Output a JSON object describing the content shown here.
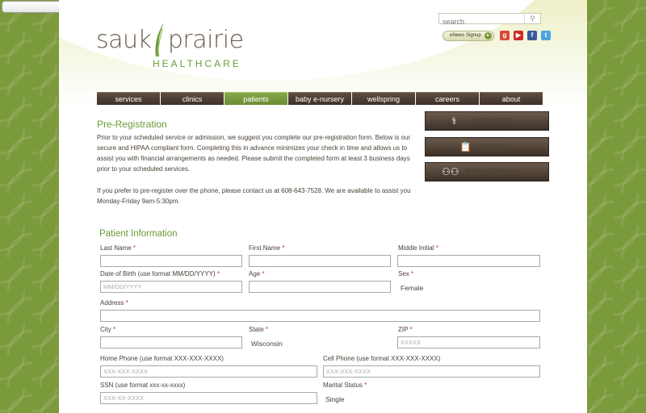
{
  "top_select": {
    "value": ""
  },
  "header": {
    "search_placeholder": "search",
    "enews_label": "eNews Signup",
    "logo_word_left": "sauk",
    "logo_word_right": "prairie",
    "logo_sub": "HEALTHCARE"
  },
  "nav": {
    "items": [
      {
        "label": "services"
      },
      {
        "label": "clinics"
      },
      {
        "label": "patients"
      },
      {
        "label": "baby e-nursery"
      },
      {
        "label": "wellspring"
      },
      {
        "label": "careers"
      },
      {
        "label": "about"
      }
    ]
  },
  "colors": {
    "accent_green": "#6b9a36",
    "nav_brown": "#3e3128",
    "required_red": "#c0302a"
  },
  "content": {
    "title": "Pre-Registration",
    "para1": "Prior to your scheduled service or admission, we suggest you complete our pre-registration form. Below is our secure and HIPAA compliant form.  Completing this in advance minimizes your check in time and allows us to assist you with financial arrangements as needed.  Please submit the completed form at least 3 business days prior to your scheduled services.",
    "para2": "If you prefer to pre-register over the phone, please contact us at 608-643-7528.  We are available to assist you Monday-Friday 9am-5:30pm."
  },
  "side_buttons": [
    {
      "label": "Find a Doctor",
      "icon": "stethoscope-icon"
    },
    {
      "label": "MyHealth",
      "icon": "clipboard-icon"
    },
    {
      "label": "Make a Difference",
      "icon": "people-icon"
    }
  ],
  "form": {
    "section_title": "Patient Information",
    "last_name": "Last Name",
    "first_name": "First Name",
    "middle_initial": "Middle Initial",
    "dob": "Date of Birth (use format MM/DD/YYYY)",
    "dob_placeholder": "MM/DD/YYYY",
    "age": "Age",
    "sex": "Sex",
    "sex_value": "Female",
    "address": "Address",
    "city": "City",
    "state": "State",
    "state_value": "Wisconsin",
    "zip": "ZIP",
    "zip_placeholder": "XXXXX",
    "home_phone": "Home Phone (use format XXX-XXX-XXXX)",
    "home_phone_placeholder": "XXX-XXX-XXXX",
    "cell_phone": "Cell Phone (use format XXX-XXX-XXXX)",
    "cell_phone_placeholder": "XXX-XXX-XXXX",
    "ssn": "SSN (use format xxx-xx-xxxx)",
    "ssn_placeholder": "XXX-XX-XXXX",
    "marital_status": "Marital Status",
    "marital_value": "Single",
    "req_mark": "*"
  }
}
